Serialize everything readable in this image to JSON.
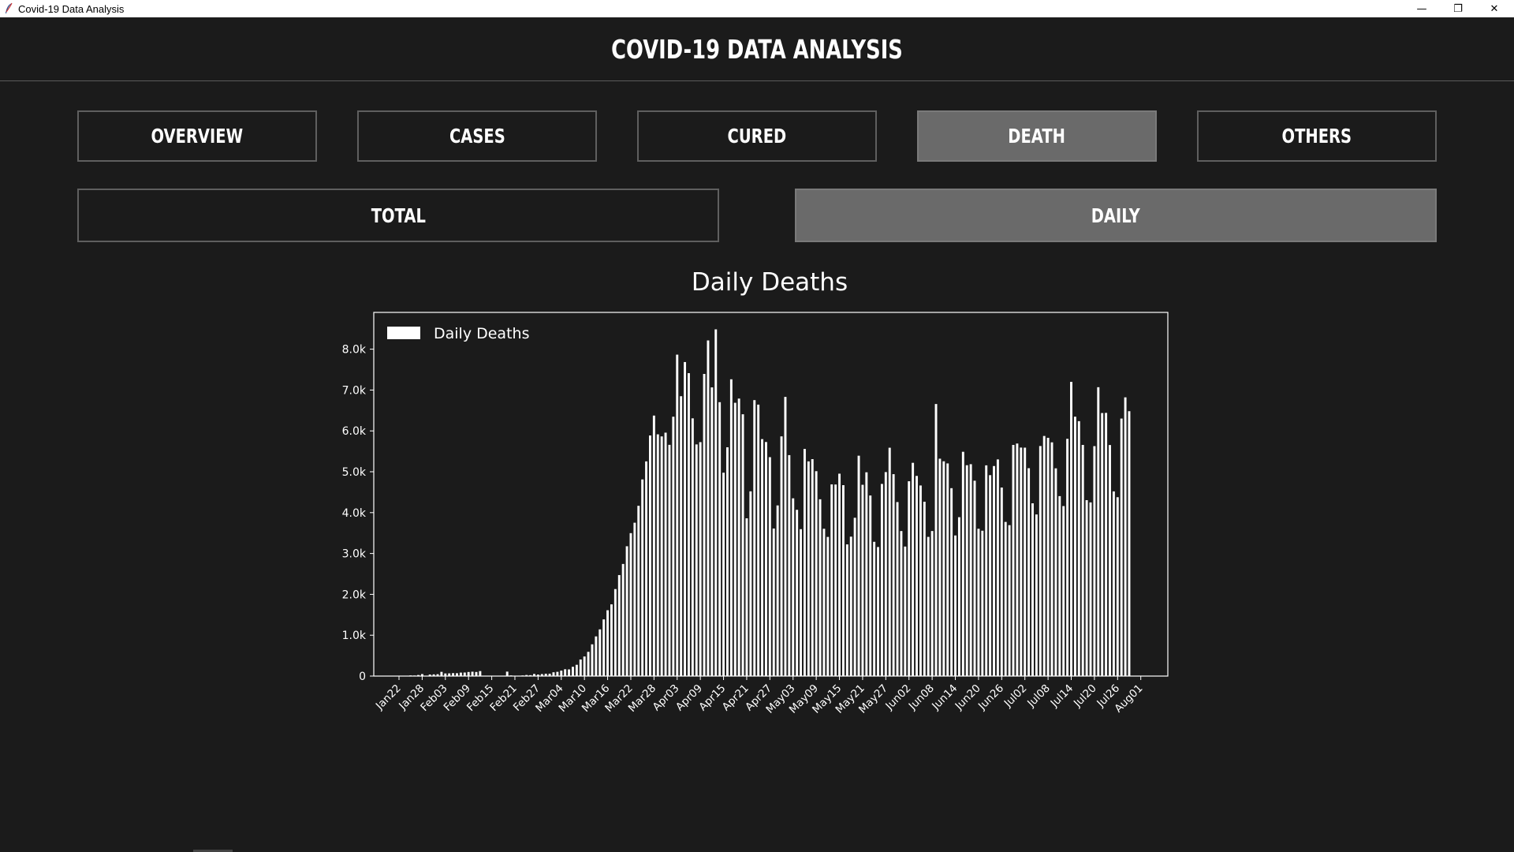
{
  "window": {
    "title": "Covid-19 Data Analysis",
    "minimize": "—",
    "restore": "❐",
    "close": "✕"
  },
  "header": {
    "title": "COVID-19 DATA ANALYSIS"
  },
  "nav": {
    "tabs": [
      {
        "label": "OVERVIEW",
        "active": false
      },
      {
        "label": "CASES",
        "active": false
      },
      {
        "label": "CURED",
        "active": false
      },
      {
        "label": "DEATH",
        "active": true
      },
      {
        "label": "OTHERS",
        "active": false
      }
    ],
    "subtabs": [
      {
        "label": "TOTAL",
        "active": false
      },
      {
        "label": "DAILY",
        "active": true
      }
    ]
  },
  "colors": {
    "background": "#1b1b1b",
    "active_button": "#6a6a6a",
    "bar": "#ffffff"
  },
  "chart_data": {
    "type": "bar",
    "title": "Daily Deaths",
    "legend": {
      "label": "Daily Deaths",
      "placement": "top-left"
    },
    "xlabel": "",
    "ylabel": "",
    "ylim": [
      0,
      8900
    ],
    "yticks": [
      0,
      1000,
      2000,
      3000,
      4000,
      5000,
      6000,
      7000,
      8000
    ],
    "ytick_labels": [
      "0",
      "1.0k",
      "2.0k",
      "3.0k",
      "4.0k",
      "5.0k",
      "6.0k",
      "7.0k",
      "8.0k"
    ],
    "xtick_labels": [
      "Jan22",
      "Jan28",
      "Feb03",
      "Feb09",
      "Feb15",
      "Feb21",
      "Feb27",
      "Mar04",
      "Mar10",
      "Mar16",
      "Mar22",
      "Mar28",
      "Apr03",
      "Apr09",
      "Apr15",
      "Apr21",
      "Apr27",
      "May03",
      "May09",
      "May15",
      "May21",
      "May27",
      "Jun02",
      "Jun08",
      "Jun14",
      "Jun20",
      "Jun26",
      "Jul02",
      "Jul08",
      "Jul14",
      "Jul20",
      "Jul26",
      "Aug01"
    ],
    "tick_every": 6,
    "values": [
      0,
      1,
      8,
      16,
      14,
      26,
      49,
      2,
      38,
      42,
      46,
      103,
      64,
      66,
      72,
      70,
      85,
      87,
      100,
      107,
      100,
      122,
      4,
      5,
      3,
      7,
      7,
      7,
      109,
      16,
      3,
      4,
      15,
      26,
      22,
      52,
      37,
      49,
      58,
      58,
      93,
      104,
      133,
      167,
      163,
      227,
      276,
      406,
      479,
      593,
      777,
      971,
      1143,
      1387,
      1611,
      1755,
      2129,
      2472,
      2744,
      3177,
      3498,
      3753,
      4167,
      4812,
      5254,
      5888,
      6375,
      5916,
      5865,
      5957,
      5659,
      6347,
      7866,
      6849,
      7685,
      7413,
      6307,
      5669,
      5725,
      7394,
      8214,
      7065,
      8485,
      6703,
      4977,
      5599,
      7263,
      6688,
      6791,
      6407,
      3861,
      4521,
      6753,
      6643,
      5799,
      5728,
      5357,
      3611,
      4176,
      5866,
      6832,
      5407,
      4350,
      4069,
      3595,
      5559,
      5254,
      5309,
      5014,
      4327,
      3605,
      3405,
      4691,
      4688,
      4953,
      4672,
      3223,
      3412,
      3874,
      5393,
      4681,
      4987,
      4419,
      3286,
      3158,
      4702,
      4992,
      5588,
      4941,
      4258,
      3549,
      3170,
      4768,
      5219,
      4898,
      4664,
      4267,
      3406,
      3550,
      6658,
      5320,
      5256,
      5204,
      4598,
      3441,
      3888,
      5489,
      5160,
      5185,
      4781,
      3605,
      3557,
      5157,
      4917,
      5140,
      5302,
      4614,
      3772,
      3693,
      5657,
      5691,
      5592,
      5590,
      5087,
      4228,
      3955,
      5630,
      5876,
      5831,
      5720,
      5084,
      4404,
      4160,
      5806,
      7200,
      6348,
      6238,
      5657,
      4305,
      4250,
      5627,
      7069,
      6437,
      6441,
      5654,
      4519,
      4377,
      6302,
      6821,
      6482
    ]
  }
}
